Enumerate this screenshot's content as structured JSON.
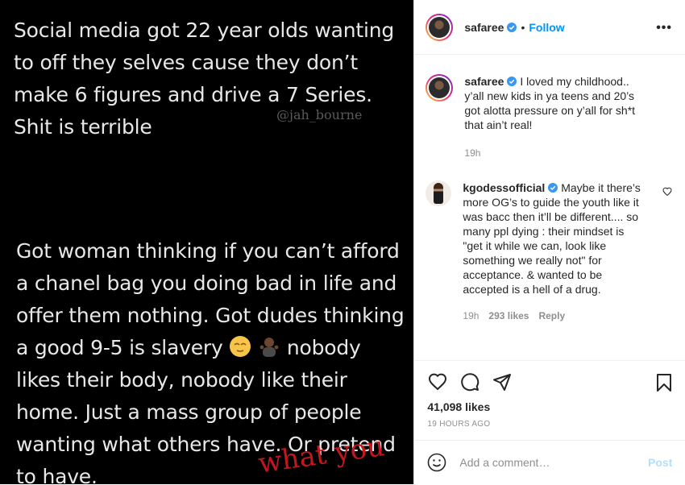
{
  "media": {
    "text1": "Social media got 22 year olds wanting to off they selves cause they don’t make 6 figures and drive a 7 Series. Shit is terrible",
    "watermark": "@jah_bourne",
    "text2a": "Got woman thinking if you can’t afford a chanel bag you doing bad in life and offer them nothing. Got dudes thinking a good 9-5 is slavery",
    "text2b": "nobody likes their body, nobody like their home. Just a mass group of people wanting what others have. Or pretend to have.",
    "red_text": "what you"
  },
  "header": {
    "username": "safaree",
    "separator": "•",
    "follow_label": "Follow",
    "more_label": "•••"
  },
  "caption": {
    "username": "safaree",
    "text": "I loved my childhood.. y’all new kids in ya teens and 20’s got alotta pressure on y’all for sh*t that ain’t real!",
    "time": "19h"
  },
  "comment": {
    "username": "kgodessofficial",
    "text": "Maybe it there’s more OG’s to guide the youth like it was bacc then it’ll be different.... so many ppl dying : their mindset is \"get it while we can, look like something we really not\" for acceptance. & wanted to be accepted is a hell of a drug.",
    "time": "19h",
    "likes": "293 likes",
    "reply": "Reply"
  },
  "actions": {
    "likes": "41,098 likes",
    "timestamp": "19 HOURS AGO"
  },
  "add_comment": {
    "placeholder": "Add a comment…",
    "post_label": "Post"
  },
  "colors": {
    "accent": "#0095f6",
    "post_disabled": "#b2dffc",
    "muted": "#8e8e8e",
    "red_overlay": "#c4161c"
  }
}
